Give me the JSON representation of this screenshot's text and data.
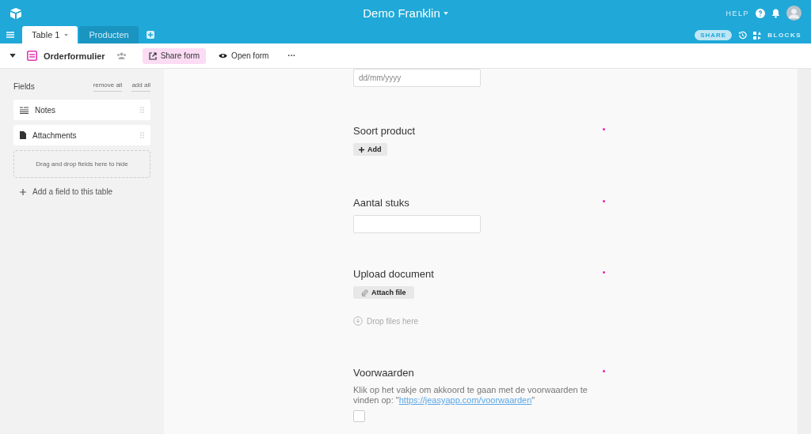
{
  "app": {
    "title": "Demo Franklin",
    "help": "HELP",
    "share": "SHARE",
    "blocks": "BLOCKS"
  },
  "tabs": [
    {
      "label": "Table 1",
      "selected": true
    },
    {
      "label": "Producten",
      "selected": false
    }
  ],
  "toolbar": {
    "view": "Orderformulier",
    "share_form": "Share form",
    "open_form": "Open form",
    "more": "···"
  },
  "sidebar": {
    "title": "Fields",
    "remove_all": "remove all",
    "add_all": "add all",
    "fields": [
      {
        "label": "Notes",
        "kind": "notes"
      },
      {
        "label": "Attachments",
        "kind": "attachment"
      }
    ],
    "drop_hint": "Drag and drop fields here to hide",
    "add_field": "Add a field to this table"
  },
  "form": [
    {
      "kind": "date",
      "placeholder": "dd/mm/yyyy",
      "required": false
    },
    {
      "kind": "select",
      "label": "Soort product",
      "button": "Add",
      "required": true
    },
    {
      "kind": "number",
      "label": "Aantal stuks",
      "required": true
    },
    {
      "kind": "attachment",
      "label": "Upload document",
      "button": "Attach file",
      "drop": "Drop files here",
      "required": true
    },
    {
      "kind": "checkbox",
      "label": "Voorwaarden",
      "description": "Klik op het vakje om akkoord te gaan met de voorwaarden te vinden op: \"",
      "link": "https://jeasyapp.com/voorwaarden",
      "description_end": "\"",
      "checked": false,
      "required": true
    }
  ]
}
